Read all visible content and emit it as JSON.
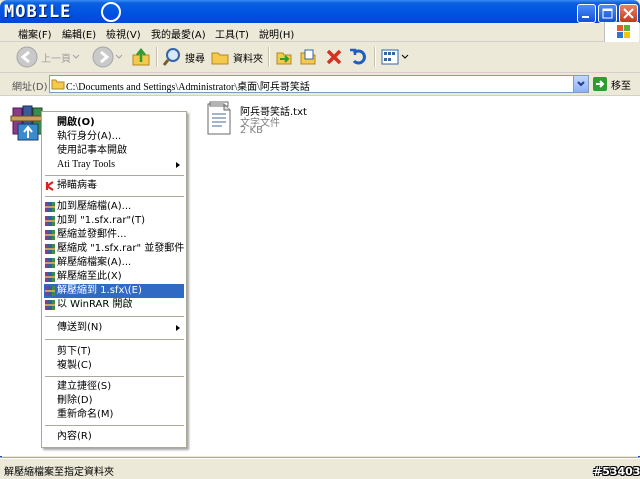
{
  "window": {
    "title_logo": "MOBILE",
    "minimize_icon": "minimize-icon",
    "maximize_icon": "maximize-icon",
    "close_icon": "close-icon"
  },
  "menubar": {
    "items": [
      "檔案(F)",
      "編輯(E)",
      "檢視(V)",
      "我的最愛(A)",
      "工具(T)",
      "說明(H)"
    ]
  },
  "toolbar": {
    "back_label": "上一頁",
    "search_label": "搜尋",
    "folders_label": "資料夾"
  },
  "address": {
    "label": "網址(D)",
    "path": "C:\\Documents and Settings\\Administrator\\桌面\\阿兵哥笑話",
    "go_label": "移至"
  },
  "file": {
    "name": "阿兵哥笑話.txt",
    "type": "文字文件",
    "size": "2 KB"
  },
  "context_menu": {
    "items": [
      {
        "label": "開啟(O)",
        "bold": true,
        "icon": ""
      },
      {
        "label": "執行身分(A)...",
        "icon": ""
      },
      {
        "label": "使用記事本開啟",
        "icon": ""
      },
      {
        "label": "Ati Tray Tools",
        "icon": "",
        "submenu": true
      },
      {
        "label": "掃瞄病毒",
        "icon": "kaspersky-icon"
      },
      {
        "label": "加到壓縮檔(A)...",
        "icon": "winrar-icon"
      },
      {
        "label": "加到 \"1.sfx.rar\"(T)",
        "icon": "winrar-icon"
      },
      {
        "label": "壓縮並發郵件...",
        "icon": "winrar-icon"
      },
      {
        "label": "壓縮成 \"1.sfx.rar\" 並發郵件",
        "icon": "winrar-icon"
      },
      {
        "label": "解壓縮檔案(A)...",
        "icon": "winrar-icon"
      },
      {
        "label": "解壓縮至此(X)",
        "icon": "winrar-icon"
      },
      {
        "label": "解壓縮到 1.sfx\\(E)",
        "icon": "winrar-icon",
        "highlighted": true
      },
      {
        "label": "以 WinRAR 開啟",
        "icon": "winrar-icon"
      },
      {
        "label": "傳送到(N)",
        "icon": "",
        "submenu": true
      },
      {
        "label": "剪下(T)",
        "icon": ""
      },
      {
        "label": "複製(C)",
        "icon": ""
      },
      {
        "label": "建立捷徑(S)",
        "icon": ""
      },
      {
        "label": "刪除(D)",
        "icon": ""
      },
      {
        "label": "重新命名(M)",
        "icon": ""
      },
      {
        "label": "內容(R)",
        "icon": ""
      }
    ]
  },
  "statusbar": {
    "text": "解壓縮檔案至指定資料夾"
  },
  "watermark": "#53403",
  "colors": {
    "titlebar": "#0054E3",
    "highlight": "#316AC5",
    "chrome": "#ECE9D8"
  }
}
